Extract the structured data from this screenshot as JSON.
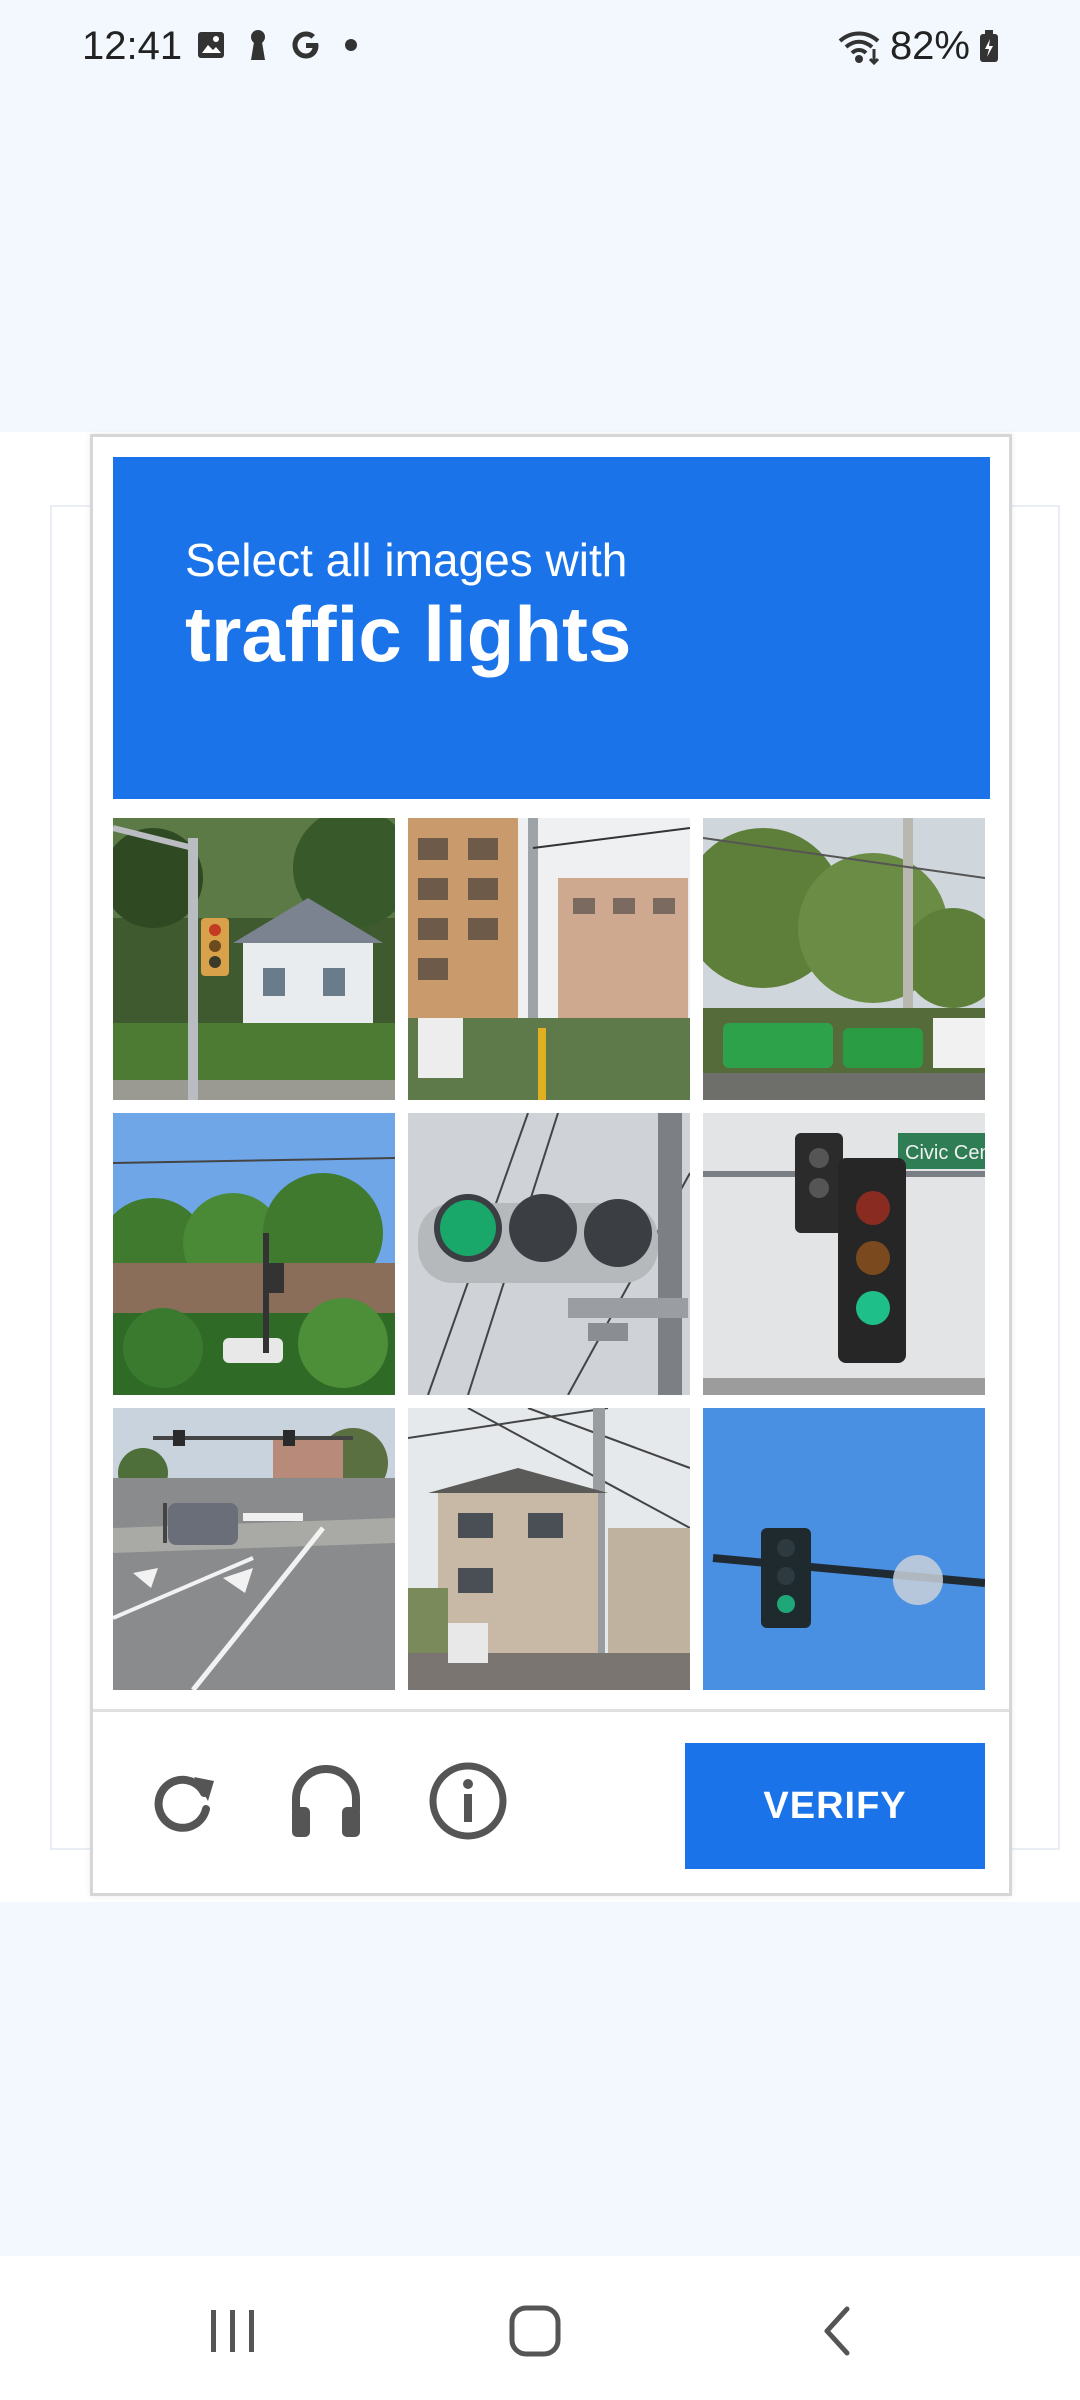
{
  "status_bar": {
    "time": "12:41",
    "battery": "82%",
    "notification_icons": [
      "gallery-icon",
      "keyhole-icon",
      "google-icon",
      "dot-icon"
    ]
  },
  "captcha": {
    "prompt_line1": "Select all images with",
    "prompt_target": "traffic lights",
    "accent_color": "#1a73e8",
    "tiles": [
      {
        "row": 1,
        "col": 1,
        "description": "street corner with traffic signal and white house"
      },
      {
        "row": 1,
        "col": 2,
        "description": "apartment buildings with utility pole"
      },
      {
        "row": 1,
        "col": 3,
        "description": "trees and green vehicles by road"
      },
      {
        "row": 2,
        "col": 1,
        "description": "intersection with trees and cars"
      },
      {
        "row": 2,
        "col": 2,
        "description": "close-up green traffic light"
      },
      {
        "row": 2,
        "col": 3,
        "description": "traffic light with street sign"
      },
      {
        "row": 3,
        "col": 1,
        "description": "multi-lane road intersection"
      },
      {
        "row": 3,
        "col": 2,
        "description": "house with power lines"
      },
      {
        "row": 3,
        "col": 3,
        "description": "traffic light against blue sky"
      }
    ],
    "street_sign_text": "Civic Cen",
    "footer": {
      "reload_icon": "reload-icon",
      "audio_icon": "headphones-icon",
      "info_icon": "info-icon",
      "verify_label": "VERIFY"
    }
  },
  "nav_bar": {
    "recents_icon": "recents-icon",
    "home_icon": "home-icon",
    "back_icon": "back-icon"
  }
}
